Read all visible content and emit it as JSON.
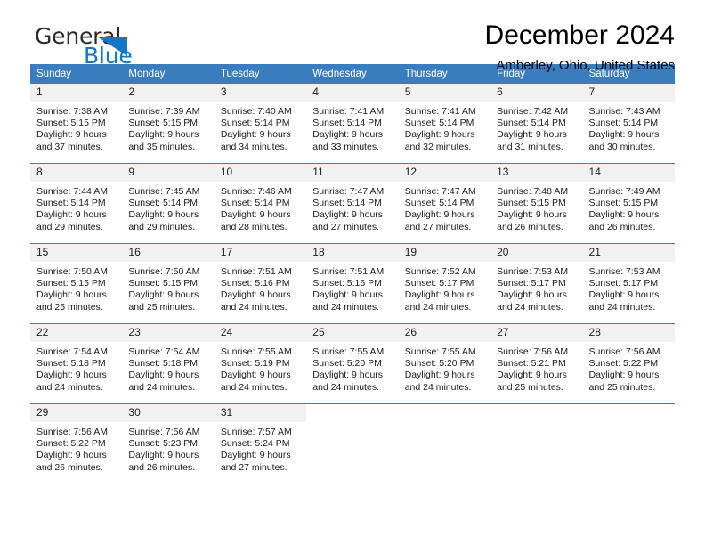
{
  "brand": {
    "name_part1": "General",
    "name_part2": "Blue",
    "accent_color": "#1476c6"
  },
  "header": {
    "title": "December 2024",
    "subtitle": "Amberley, Ohio, United States"
  },
  "theme": {
    "header_row_bg": "#3a7dbf",
    "daynum_bg": "#f1f1f1",
    "row_divider": "#3a7dbf"
  },
  "weekday_headers": [
    "Sunday",
    "Monday",
    "Tuesday",
    "Wednesday",
    "Thursday",
    "Friday",
    "Saturday"
  ],
  "weeks": [
    [
      {
        "day": "1",
        "sunrise": "Sunrise: 7:38 AM",
        "sunset": "Sunset: 5:15 PM",
        "daylight_line1": "Daylight: 9 hours",
        "daylight_line2": "and 37 minutes."
      },
      {
        "day": "2",
        "sunrise": "Sunrise: 7:39 AM",
        "sunset": "Sunset: 5:15 PM",
        "daylight_line1": "Daylight: 9 hours",
        "daylight_line2": "and 35 minutes."
      },
      {
        "day": "3",
        "sunrise": "Sunrise: 7:40 AM",
        "sunset": "Sunset: 5:14 PM",
        "daylight_line1": "Daylight: 9 hours",
        "daylight_line2": "and 34 minutes."
      },
      {
        "day": "4",
        "sunrise": "Sunrise: 7:41 AM",
        "sunset": "Sunset: 5:14 PM",
        "daylight_line1": "Daylight: 9 hours",
        "daylight_line2": "and 33 minutes."
      },
      {
        "day": "5",
        "sunrise": "Sunrise: 7:41 AM",
        "sunset": "Sunset: 5:14 PM",
        "daylight_line1": "Daylight: 9 hours",
        "daylight_line2": "and 32 minutes."
      },
      {
        "day": "6",
        "sunrise": "Sunrise: 7:42 AM",
        "sunset": "Sunset: 5:14 PM",
        "daylight_line1": "Daylight: 9 hours",
        "daylight_line2": "and 31 minutes."
      },
      {
        "day": "7",
        "sunrise": "Sunrise: 7:43 AM",
        "sunset": "Sunset: 5:14 PM",
        "daylight_line1": "Daylight: 9 hours",
        "daylight_line2": "and 30 minutes."
      }
    ],
    [
      {
        "day": "8",
        "sunrise": "Sunrise: 7:44 AM",
        "sunset": "Sunset: 5:14 PM",
        "daylight_line1": "Daylight: 9 hours",
        "daylight_line2": "and 29 minutes."
      },
      {
        "day": "9",
        "sunrise": "Sunrise: 7:45 AM",
        "sunset": "Sunset: 5:14 PM",
        "daylight_line1": "Daylight: 9 hours",
        "daylight_line2": "and 29 minutes."
      },
      {
        "day": "10",
        "sunrise": "Sunrise: 7:46 AM",
        "sunset": "Sunset: 5:14 PM",
        "daylight_line1": "Daylight: 9 hours",
        "daylight_line2": "and 28 minutes."
      },
      {
        "day": "11",
        "sunrise": "Sunrise: 7:47 AM",
        "sunset": "Sunset: 5:14 PM",
        "daylight_line1": "Daylight: 9 hours",
        "daylight_line2": "and 27 minutes."
      },
      {
        "day": "12",
        "sunrise": "Sunrise: 7:47 AM",
        "sunset": "Sunset: 5:14 PM",
        "daylight_line1": "Daylight: 9 hours",
        "daylight_line2": "and 27 minutes."
      },
      {
        "day": "13",
        "sunrise": "Sunrise: 7:48 AM",
        "sunset": "Sunset: 5:15 PM",
        "daylight_line1": "Daylight: 9 hours",
        "daylight_line2": "and 26 minutes."
      },
      {
        "day": "14",
        "sunrise": "Sunrise: 7:49 AM",
        "sunset": "Sunset: 5:15 PM",
        "daylight_line1": "Daylight: 9 hours",
        "daylight_line2": "and 26 minutes."
      }
    ],
    [
      {
        "day": "15",
        "sunrise": "Sunrise: 7:50 AM",
        "sunset": "Sunset: 5:15 PM",
        "daylight_line1": "Daylight: 9 hours",
        "daylight_line2": "and 25 minutes."
      },
      {
        "day": "16",
        "sunrise": "Sunrise: 7:50 AM",
        "sunset": "Sunset: 5:15 PM",
        "daylight_line1": "Daylight: 9 hours",
        "daylight_line2": "and 25 minutes."
      },
      {
        "day": "17",
        "sunrise": "Sunrise: 7:51 AM",
        "sunset": "Sunset: 5:16 PM",
        "daylight_line1": "Daylight: 9 hours",
        "daylight_line2": "and 24 minutes."
      },
      {
        "day": "18",
        "sunrise": "Sunrise: 7:51 AM",
        "sunset": "Sunset: 5:16 PM",
        "daylight_line1": "Daylight: 9 hours",
        "daylight_line2": "and 24 minutes."
      },
      {
        "day": "19",
        "sunrise": "Sunrise: 7:52 AM",
        "sunset": "Sunset: 5:17 PM",
        "daylight_line1": "Daylight: 9 hours",
        "daylight_line2": "and 24 minutes."
      },
      {
        "day": "20",
        "sunrise": "Sunrise: 7:53 AM",
        "sunset": "Sunset: 5:17 PM",
        "daylight_line1": "Daylight: 9 hours",
        "daylight_line2": "and 24 minutes."
      },
      {
        "day": "21",
        "sunrise": "Sunrise: 7:53 AM",
        "sunset": "Sunset: 5:17 PM",
        "daylight_line1": "Daylight: 9 hours",
        "daylight_line2": "and 24 minutes."
      }
    ],
    [
      {
        "day": "22",
        "sunrise": "Sunrise: 7:54 AM",
        "sunset": "Sunset: 5:18 PM",
        "daylight_line1": "Daylight: 9 hours",
        "daylight_line2": "and 24 minutes."
      },
      {
        "day": "23",
        "sunrise": "Sunrise: 7:54 AM",
        "sunset": "Sunset: 5:18 PM",
        "daylight_line1": "Daylight: 9 hours",
        "daylight_line2": "and 24 minutes."
      },
      {
        "day": "24",
        "sunrise": "Sunrise: 7:55 AM",
        "sunset": "Sunset: 5:19 PM",
        "daylight_line1": "Daylight: 9 hours",
        "daylight_line2": "and 24 minutes."
      },
      {
        "day": "25",
        "sunrise": "Sunrise: 7:55 AM",
        "sunset": "Sunset: 5:20 PM",
        "daylight_line1": "Daylight: 9 hours",
        "daylight_line2": "and 24 minutes."
      },
      {
        "day": "26",
        "sunrise": "Sunrise: 7:55 AM",
        "sunset": "Sunset: 5:20 PM",
        "daylight_line1": "Daylight: 9 hours",
        "daylight_line2": "and 24 minutes."
      },
      {
        "day": "27",
        "sunrise": "Sunrise: 7:56 AM",
        "sunset": "Sunset: 5:21 PM",
        "daylight_line1": "Daylight: 9 hours",
        "daylight_line2": "and 25 minutes."
      },
      {
        "day": "28",
        "sunrise": "Sunrise: 7:56 AM",
        "sunset": "Sunset: 5:22 PM",
        "daylight_line1": "Daylight: 9 hours",
        "daylight_line2": "and 25 minutes."
      }
    ],
    [
      {
        "day": "29",
        "sunrise": "Sunrise: 7:56 AM",
        "sunset": "Sunset: 5:22 PM",
        "daylight_line1": "Daylight: 9 hours",
        "daylight_line2": "and 26 minutes."
      },
      {
        "day": "30",
        "sunrise": "Sunrise: 7:56 AM",
        "sunset": "Sunset: 5:23 PM",
        "daylight_line1": "Daylight: 9 hours",
        "daylight_line2": "and 26 minutes."
      },
      {
        "day": "31",
        "sunrise": "Sunrise: 7:57 AM",
        "sunset": "Sunset: 5:24 PM",
        "daylight_line1": "Daylight: 9 hours",
        "daylight_line2": "and 27 minutes."
      },
      {
        "day": "",
        "sunrise": "",
        "sunset": "",
        "daylight_line1": "",
        "daylight_line2": ""
      },
      {
        "day": "",
        "sunrise": "",
        "sunset": "",
        "daylight_line1": "",
        "daylight_line2": ""
      },
      {
        "day": "",
        "sunrise": "",
        "sunset": "",
        "daylight_line1": "",
        "daylight_line2": ""
      },
      {
        "day": "",
        "sunrise": "",
        "sunset": "",
        "daylight_line1": "",
        "daylight_line2": ""
      }
    ]
  ]
}
